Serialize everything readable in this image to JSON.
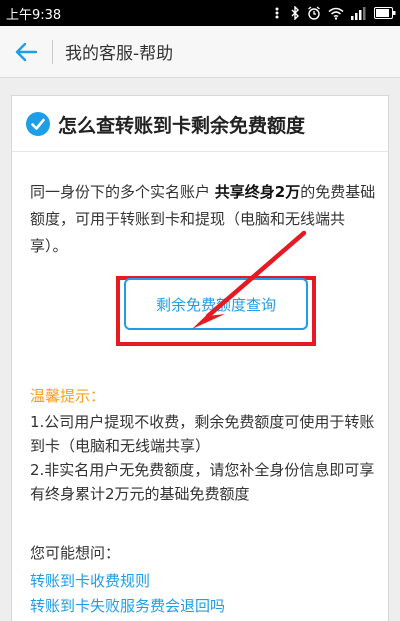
{
  "status_bar": {
    "time": "上午9:38",
    "icons": [
      "dots-icon",
      "bluetooth-icon",
      "alarm-icon",
      "wifi-icon",
      "signal-icon",
      "battery-icon"
    ]
  },
  "nav": {
    "back_icon": "back-arrow-icon",
    "title": "我的客服-帮助"
  },
  "card": {
    "title_icon": "check-circle-icon",
    "title": "怎么查转账到卡剩余免费额度",
    "description": {
      "part1": "同一身份下的多个实名账户 ",
      "bold": "共享终身2万",
      "part2": "的免费基础额度，可用于转账到卡和提现（电脑和无线端共享）。"
    },
    "query_button": "剩余免费额度查询",
    "tips": {
      "heading": "温馨提示：",
      "items": [
        "1.公司用户提现不收费，剩余免费额度可使用于转账到卡（电脑和无线端共享）",
        "2.非实名用户无免费额度，请您补全身份信息即可享有终身累计2万元的基础免费额度"
      ]
    },
    "related": {
      "heading": "您可能想问：",
      "links": [
        "转账到卡收费规则",
        "转账到卡失败服务费会退回吗"
      ]
    }
  },
  "colors": {
    "accent_blue": "#1e9ee6",
    "tip_orange": "#f7a11a",
    "highlight_red": "#e41b23"
  }
}
